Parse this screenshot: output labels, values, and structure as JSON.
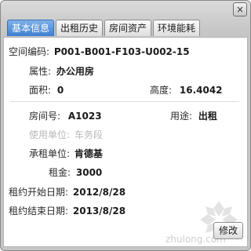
{
  "tabs": [
    {
      "label": "基本信息",
      "active": true
    },
    {
      "label": "出租历史",
      "active": false
    },
    {
      "label": "房间资产",
      "active": false
    },
    {
      "label": "环境能耗",
      "active": false
    }
  ],
  "close_glyph": "×",
  "fields": {
    "space_code_label": "空间编码:",
    "space_code_value": "P001-B001-F103-U002-15",
    "attribute_label": "属性:",
    "attribute_value": "办公用房",
    "area_label": "面积:",
    "area_value": "0",
    "height_label": "高度:",
    "height_value": "16.4042",
    "room_no_label": "房间号:",
    "room_no_value": "A1023",
    "purpose_label": "用途:",
    "purpose_value": "出租",
    "user_unit_label": "使用单位:",
    "user_unit_value": "车务段",
    "tenant_label": "承租单位:",
    "tenant_value": "肯德基",
    "rent_label": "租金:",
    "rent_value": "3000",
    "lease_start_label": "租约开始日期:",
    "lease_start_value": "2012/8/28",
    "lease_end_label": "租约结束日期:",
    "lease_end_value": "2013/8/28"
  },
  "edit_button_label": "修改",
  "watermark": "zhulong.com"
}
